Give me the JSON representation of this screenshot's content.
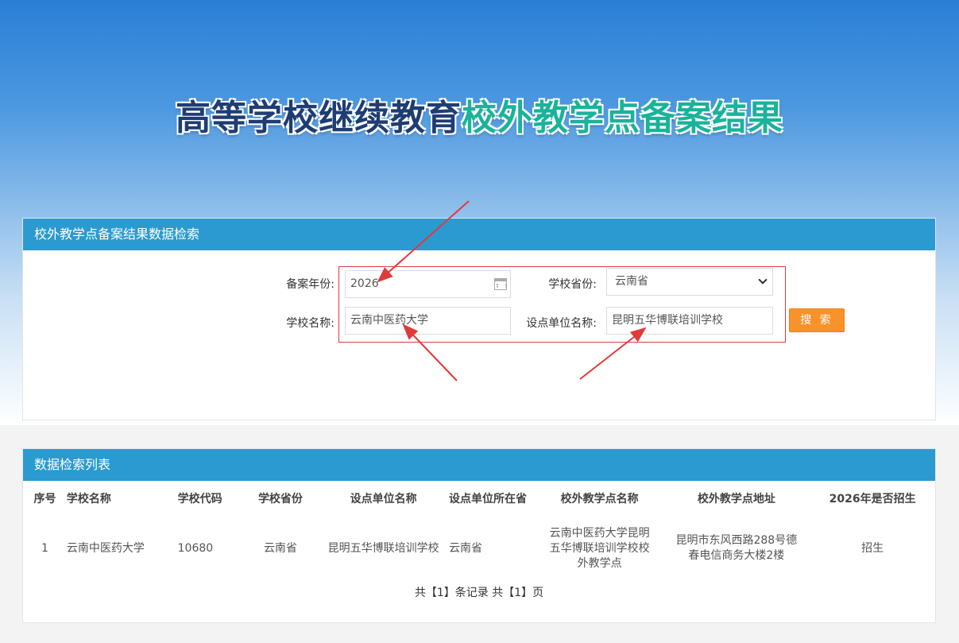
{
  "hero": {
    "title_part1": "高等学校继续教育",
    "title_part2": "校外教学点备案结果"
  },
  "search": {
    "header": "校外教学点备案结果数据检索",
    "year_label": "备案年份:",
    "year_value": "2026",
    "province_label": "学校省份:",
    "province_value": "云南省",
    "school_label": "学校名称:",
    "school_value": "云南中医药大学",
    "unit_label": "设点单位名称:",
    "unit_value": "昆明五华博联培训学校",
    "button_label": "搜 索"
  },
  "results": {
    "header": "数据检索列表",
    "columns": [
      "序号",
      "学校名称",
      "学校代码",
      "学校省份",
      "设点单位名称",
      "设点单位所在省",
      "校外教学点名称",
      "校外教学点地址",
      "2026年是否招生"
    ],
    "rows": [
      [
        "1",
        "云南中医药大学",
        "10680",
        "云南省",
        "昆明五华博联培训学校",
        "云南省",
        "云南中医药大学昆明五华博联培训学校校外教学点",
        "昆明市东风西路288号德春电信商务大楼2楼",
        "招生"
      ]
    ],
    "pager": "共【1】条记录 共【1】页"
  },
  "colors": {
    "panel_header": "#2b9ad0",
    "button": "#f8922a",
    "highlight_box": "#e03a3a",
    "title_dark": "#1e3d73",
    "title_green": "#19b39a"
  }
}
